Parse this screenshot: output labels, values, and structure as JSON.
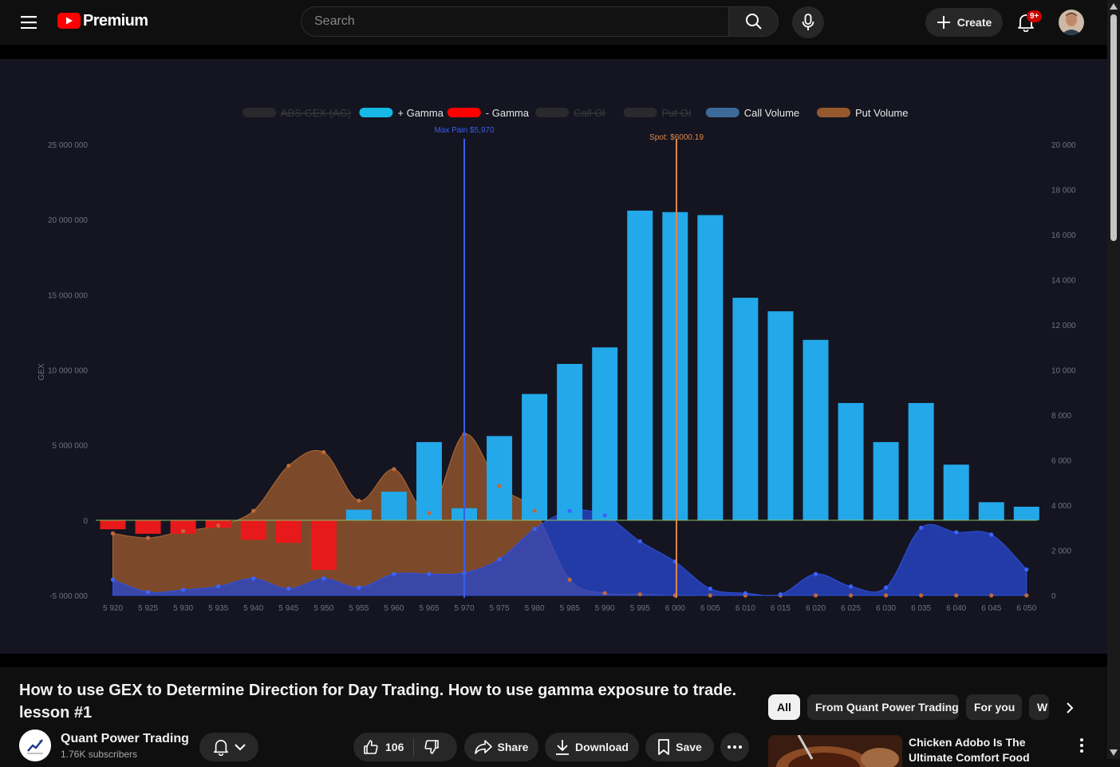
{
  "header": {
    "brand": "Premium",
    "search_placeholder": "Search",
    "create_label": "Create",
    "notifications_badge": "9+"
  },
  "video": {
    "title": "How to use GEX to Determine Direction for Day Trading. How to use gamma exposure to trade. lesson #1",
    "channel_name": "Quant Power Trading",
    "subscribers": "1.76K subscribers",
    "likes": "106",
    "share_label": "Share",
    "download_label": "Download",
    "save_label": "Save"
  },
  "recommendations": {
    "chips": [
      "All",
      "From Quant Power Trading",
      "For you",
      "W"
    ],
    "first_title": "Chicken Adobo Is The Ultimate Comfort Food"
  },
  "chart_data": {
    "type": "bar",
    "legend": [
      {
        "label": "ABS GEX (AG)",
        "color": "#3a3a3a",
        "hidden": true
      },
      {
        "label": "+ Gamma",
        "color": "#16b8e6",
        "hidden": false
      },
      {
        "label": "- Gamma",
        "color": "#ff0000",
        "hidden": false
      },
      {
        "label": "Call OI",
        "color": "#3a3a3a",
        "hidden": true
      },
      {
        "label": "Put OI",
        "color": "#3a3a3a",
        "hidden": true
      },
      {
        "label": "Call Volume",
        "color": "#3c6a9b",
        "hidden": false
      },
      {
        "label": "Put Volume",
        "color": "#96582d",
        "hidden": false
      }
    ],
    "ylabel": "GEX",
    "ylim": [
      -5000000,
      25000000
    ],
    "y_ticks": [
      "25 000 000",
      "20 000 000",
      "15 000 000",
      "10 000 000",
      "5 000 000",
      "0",
      "-5 000 000"
    ],
    "y2lim": [
      0,
      20000
    ],
    "y2_ticks": [
      "20 000",
      "18 000",
      "16 000",
      "14 000",
      "12 000",
      "10 000",
      "8 000",
      "6 000",
      "4 000",
      "2 000",
      "0"
    ],
    "categories": [
      "5 920",
      "5 925",
      "5 930",
      "5 935",
      "5 940",
      "5 945",
      "5 950",
      "5 955",
      "5 960",
      "5 965",
      "5 970",
      "5 975",
      "5 980",
      "5 985",
      "5 990",
      "5 995",
      "6 000",
      "6 005",
      "6 010",
      "6 015",
      "6 020",
      "6 025",
      "6 030",
      "6 035",
      "6 040",
      "6 045",
      "6 050"
    ],
    "gamma": [
      -600000,
      -900000,
      -900000,
      -500000,
      -1300000,
      -1500000,
      -3300000,
      700000,
      1900000,
      5200000,
      800000,
      5600000,
      8400000,
      10400000,
      11500000,
      20600000,
      20500000,
      20300000,
      14800000,
      13900000,
      12000000,
      7800000,
      5200000,
      7800000,
      3700000,
      1200000,
      900000
    ],
    "call_volume": [
      700,
      150,
      250,
      400,
      750,
      300,
      750,
      350,
      950,
      950,
      1000,
      1600,
      2950,
      3750,
      3550,
      2400,
      1500,
      300,
      100,
      50,
      950,
      400,
      350,
      3000,
      2800,
      2700,
      1150,
      3000
    ],
    "put_volume": [
      2750,
      2550,
      2850,
      3100,
      3750,
      5750,
      6350,
      4200,
      5600,
      3650,
      7150,
      4850,
      3750,
      700,
      100,
      50,
      0,
      0,
      0,
      0,
      0,
      0,
      0,
      0,
      0,
      0,
      0
    ],
    "annotations": [
      {
        "label": "Max Pain $5,970",
        "x": 5970,
        "color": "#3a5ee8"
      },
      {
        "label": "Spot: $6000.19",
        "x": 6000.19,
        "color": "#e0884a"
      }
    ]
  }
}
